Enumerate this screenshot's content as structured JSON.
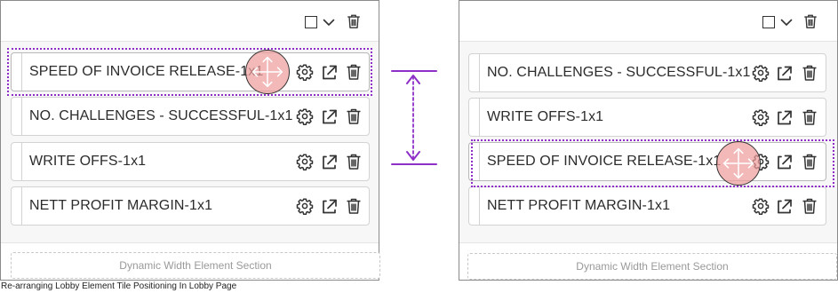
{
  "caption": "Re-arranging Lobby Element Tile Positioning In Lobby Page",
  "accent_color": "#8e2fc7",
  "drag_handle_color": "#ef9c9c",
  "icons": {
    "header": [
      "checkbox-icon",
      "chevron-down-icon",
      "trash-icon"
    ],
    "tile": [
      "gear-icon",
      "expand-arrow-icon",
      "trash-icon"
    ],
    "drag": "move-arrows-icon",
    "reorder": "vertical-double-arrow-icon"
  },
  "before": {
    "tiles": [
      {
        "label": "SPEED OF INVOICE RELEASE-1x1",
        "state": "dragging"
      },
      {
        "label": "NO. CHALLENGES - SUCCESSFUL-1x1"
      },
      {
        "label": "WRITE OFFS-1x1"
      },
      {
        "label": "NETT PROFIT MARGIN-1x1"
      }
    ],
    "dynamic_section_label": "Dynamic Width Element Section"
  },
  "after": {
    "tiles": [
      {
        "label": "NO. CHALLENGES - SUCCESSFUL-1x1"
      },
      {
        "label": "WRITE OFFS-1x1"
      },
      {
        "label": "SPEED OF INVOICE RELEASE-1x1",
        "state": "dropped"
      },
      {
        "label": "NETT PROFIT MARGIN-1x1"
      }
    ],
    "dynamic_section_label": "Dynamic Width Element Section"
  }
}
